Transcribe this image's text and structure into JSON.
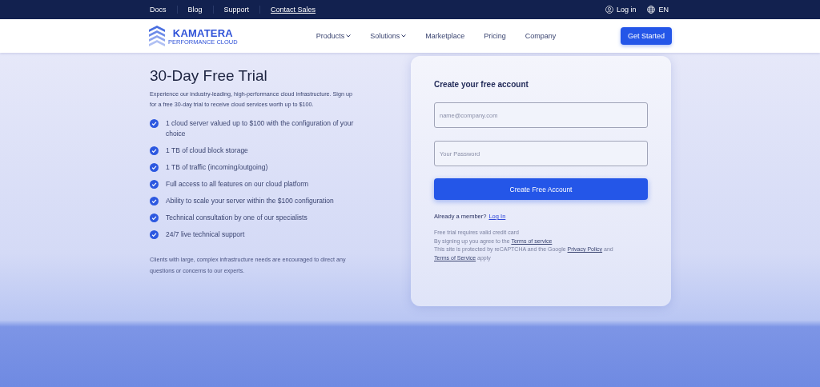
{
  "top_bar": {
    "links": [
      {
        "label": "Docs",
        "underlined": false
      },
      {
        "label": "Blog",
        "underlined": false
      },
      {
        "label": "Support",
        "underlined": false
      },
      {
        "label": "Contact Sales",
        "underlined": true
      }
    ],
    "login": "Log in",
    "language": "EN"
  },
  "header": {
    "logo": {
      "name": "KAMATERA",
      "tagline": "PERFORMANCE CLOUD"
    },
    "nav": [
      {
        "label": "Products",
        "dropdown": true
      },
      {
        "label": "Solutions",
        "dropdown": true
      },
      {
        "label": "Marketplace",
        "dropdown": false
      },
      {
        "label": "Pricing",
        "dropdown": false
      },
      {
        "label": "Company",
        "dropdown": false
      }
    ],
    "cta": "Get Started"
  },
  "intro": {
    "title": "30-Day Free Trial",
    "description": "Experience our industry-leading, high-performance cloud infrastructure. Sign up for a free 30-day trial to receive cloud services worth up to $100.",
    "features": [
      {
        "text": "1 cloud server valued up to $100 with the configuration of your choice",
        "checked": true
      },
      {
        "text": "1 TB of cloud block storage",
        "checked": true
      },
      {
        "text": "1 TB of traffic (incoming/outgoing)",
        "checked": true
      },
      {
        "text": "Full access to all features on our cloud platform",
        "checked": true
      },
      {
        "text": "Ability to scale your server within the $100 configuration",
        "checked": true
      },
      {
        "text": "Technical consultation by one of our specialists",
        "checked": true
      },
      {
        "text": "24/7 live technical support",
        "checked": true
      }
    ],
    "note": "Clients with large, complex infrastructure needs are encouraged to direct any questions or concerns to our experts."
  },
  "signup": {
    "title": "Create your free account",
    "fields": [
      {
        "placeholder": "name@company.com"
      },
      {
        "placeholder": "Your Password"
      }
    ],
    "submit": "Create Free Account",
    "member_prompt": "Already a member?",
    "member_link": "Log In",
    "legal": [
      [
        {
          "kind": "text",
          "text": "Free trial requires valid credit card"
        }
      ],
      [
        {
          "kind": "text",
          "text": "By signing up you agree to the "
        },
        {
          "kind": "link",
          "text": "Terms of service"
        }
      ],
      [
        {
          "kind": "text",
          "text": "This site is protected by reCAPTCHA and the Google "
        },
        {
          "kind": "link",
          "text": "Privacy Policy"
        },
        {
          "kind": "text",
          "text": " and"
        }
      ],
      [
        {
          "kind": "link",
          "text": "Terms of Service"
        },
        {
          "kind": "text",
          "text": " apply"
        }
      ]
    ]
  }
}
